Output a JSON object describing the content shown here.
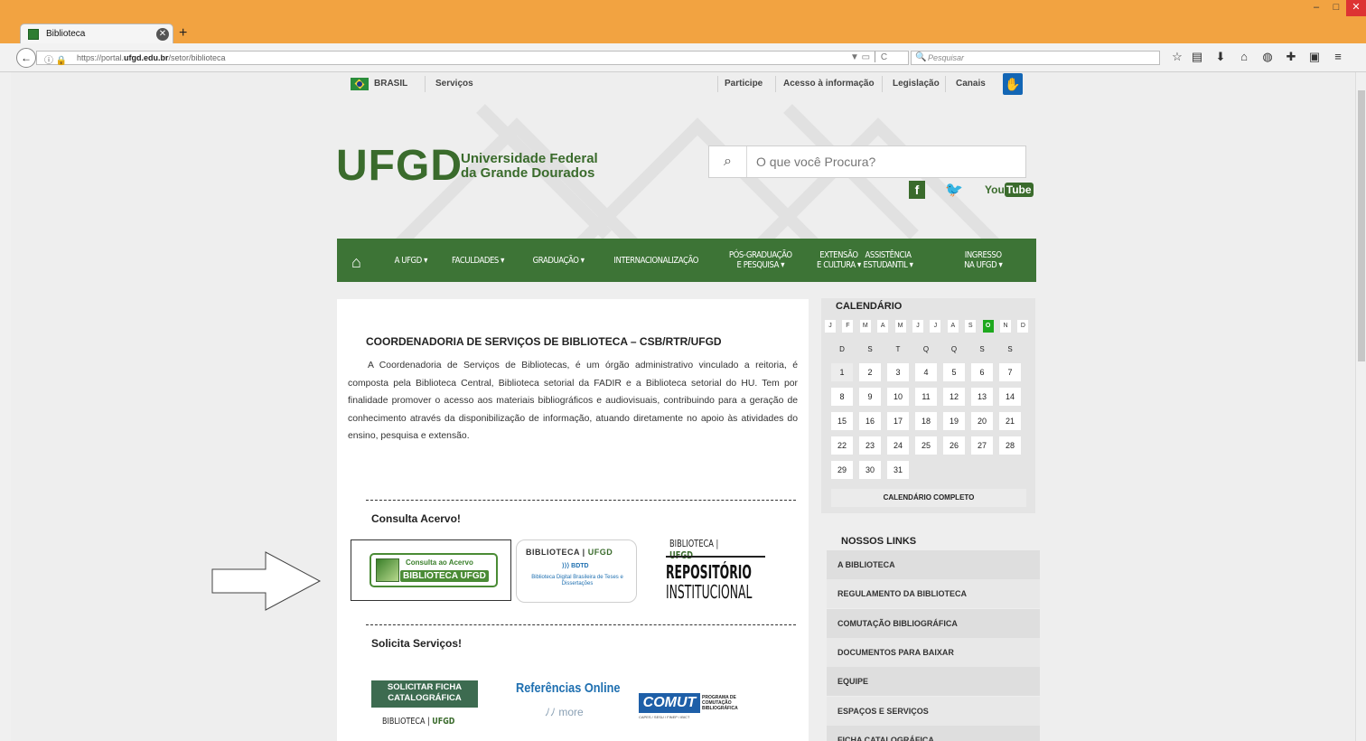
{
  "browser": {
    "tab_title": "Biblioteca",
    "tab_close": "✕",
    "new_tab": "+",
    "url_info": "ⓘ 🔒",
    "url_prefix": "https://portal.",
    "url_domain": "ufgd.edu.br",
    "url_path": "/setor/biblioteca",
    "url_tools": "▼ ▭ │ C",
    "search_icon": "🔍",
    "search_placeholder": "Pesquisar",
    "back_label": "←",
    "window": {
      "min": "–",
      "max": "□",
      "close": "✕"
    },
    "toolbar_icons": [
      "star-icon",
      "reading-list-icon",
      "download-icon",
      "home-icon",
      "pocket-icon",
      "addon-icon",
      "screenshot-icon",
      "menu-icon"
    ],
    "toolbar_glyphs": [
      "☆",
      "▤",
      "⬇",
      "⌂",
      "◍",
      "✚",
      "▣",
      "≡"
    ]
  },
  "govbar": {
    "brasil": "BRASIL",
    "servicos": "Serviços",
    "participe": "Participe",
    "acesso": "Acesso à informação",
    "legislacao": "Legislação",
    "canais": "Canais",
    "access_icon": "✋"
  },
  "logo": {
    "mark": "UFGD",
    "line1": "Universidade Federal",
    "line2": "da Grande Dourados"
  },
  "site_search": {
    "icon": "⌕",
    "placeholder": "O que você Procura?"
  },
  "social": {
    "facebook": "f",
    "twitter": "🐦",
    "youtube_you": "You",
    "youtube_tube": "Tube"
  },
  "nav": {
    "home": "⌂",
    "items": [
      {
        "line1": "A UFGD ▾",
        "line2": ""
      },
      {
        "line1": "FACULDADES ▾",
        "line2": ""
      },
      {
        "line1": "GRADUAÇÃO ▾",
        "line2": ""
      },
      {
        "line1": "INTERNACIONALIZAÇÃO",
        "line2": ""
      },
      {
        "line1": "PÓS-GRADUAÇÃO",
        "line2": "E PESQUISA ▾"
      },
      {
        "line1": "EXTENSÃO",
        "line2": "E CULTURA ▾"
      },
      {
        "line1": "ASSISTÊNCIA",
        "line2": "ESTUDANTIL ▾"
      },
      {
        "line1": "INGRESSO",
        "line2": "NA UFGD ▾"
      }
    ]
  },
  "content": {
    "title": "COORDENADORIA DE SERVIÇOS DE BIBLIOTECA – CSB/RTR/UFGD",
    "body": "A Coordenadoria de Serviços de Bibliotecas, é um órgão administrativo vinculado a reitoria, é composta pela Biblioteca Central, Biblioteca setorial da FADIR e a Biblioteca setorial do HU. Tem por finalidade promover o acesso aos materiais bibliográficos e audiovisuais, contribuindo para a geração de conhecimento através da disponibilização de informação, atuando diretamente no apoio às atividades do ensino, pesquisa e extensão.",
    "consulta_title": "Consulta Acervo!",
    "acervo_l1": "Consulta ao Acervo",
    "acervo_l2": "BIBLIOTECA UFGD",
    "bdtd_brand": "BIBLIOTECA",
    "bdtd_brand_b": "UFGD",
    "bdtd_logo": "⟩⟩⟩ BDTD",
    "bdtd_desc": "Biblioteca Digital Brasileira de Teses e Dissertações",
    "repo_brand": "BIBLIOTECA",
    "repo_brand_b": "UFGD",
    "repo_l1": "REPOSITÓRIO",
    "repo_l2": "INSTITUCIONAL",
    "servicos_title": "Solicita Serviços!",
    "ficha_badge": "SOLICITAR FICHA CATALOGRÁFICA",
    "ficha_brand": "BIBLIOTECA",
    "ficha_brand_b": "UFGD",
    "refs_title": "Referências Online",
    "refs_logo": "ﾉﾉ more",
    "comut_badge": "COMUT",
    "comut_desc": "PROGRAMA DE COMUTAÇÃO BIBLIOGRÁFICA",
    "comut_sub": "CAPES / SESU / FINEP / IBICT"
  },
  "calendar": {
    "title": "CALENDÁRIO",
    "months": [
      "J",
      "F",
      "M",
      "A",
      "M",
      "J",
      "J",
      "A",
      "S",
      "O",
      "N",
      "D"
    ],
    "active_month_index": 9,
    "weekdays": [
      "D",
      "S",
      "T",
      "Q",
      "Q",
      "S",
      "S"
    ],
    "days": [
      "1",
      "2",
      "3",
      "4",
      "5",
      "6",
      "7",
      "8",
      "9",
      "10",
      "11",
      "12",
      "13",
      "14",
      "15",
      "16",
      "17",
      "18",
      "19",
      "20",
      "21",
      "22",
      "23",
      "24",
      "25",
      "26",
      "27",
      "28",
      "29",
      "30",
      "31"
    ],
    "full_link": "CALENDÁRIO COMPLETO"
  },
  "links": {
    "title": "NOSSOS LINKS",
    "items": [
      "A BIBLIOTECA",
      "REGULAMENTO DA BIBLIOTECA",
      "COMUTAÇÃO BIBLIOGRÁFICA",
      "DOCUMENTOS PARA BAIXAR",
      "EQUIPE",
      "ESPAÇOS E SERVIÇOS",
      "FICHA CATALOGRÁFICA"
    ]
  },
  "colors": {
    "brand_green": "#3d7436",
    "title_bar": "#f2a341",
    "calendar_active": "#1ea81e"
  }
}
